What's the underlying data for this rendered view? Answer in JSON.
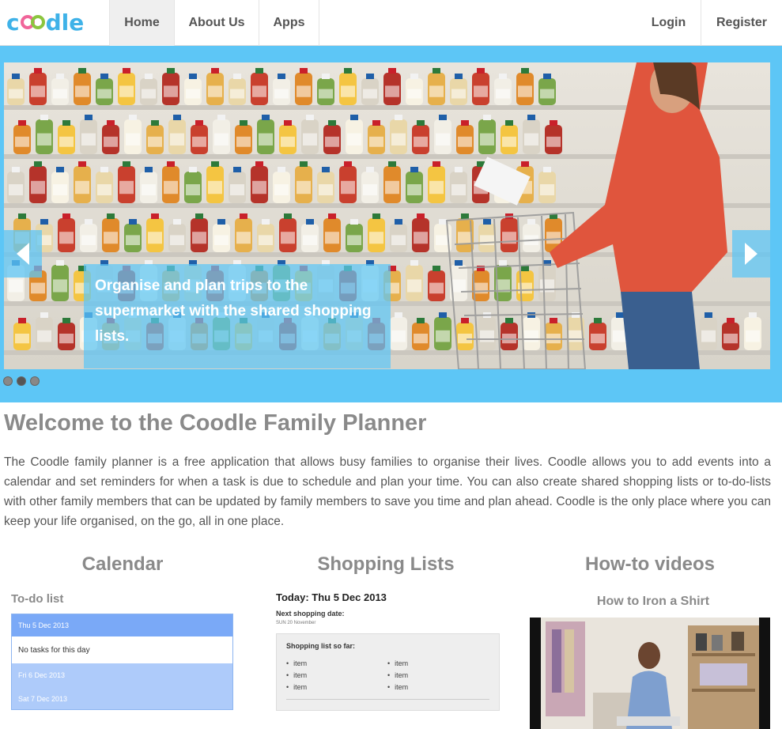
{
  "nav": {
    "logo": "coodle",
    "items": [
      "Home",
      "About Us",
      "Apps"
    ],
    "right": [
      "Login",
      "Register"
    ],
    "active": "Home"
  },
  "hero": {
    "caption": "Organise and plan trips to the supermarket with the shared shopping lists.",
    "slide_count": 3,
    "active_slide": 2
  },
  "welcome": {
    "title": "Welcome to the Coodle Family Planner",
    "body": "The Coodle family planner is a free application that allows busy families to organise their lives. Coodle allows you to add events into a calendar and set reminders for when a task is due to schedule and plan your time. You can also create shared shopping lists or to-do-lists with other family members that can be updated by family members to save you time and plan ahead. Coodle is the only place where you can keep your life organised, on the go, all in one place."
  },
  "columns": {
    "calendar": {
      "title": "Calendar",
      "todo_title": "To-do list",
      "rows": [
        "Thu 5 Dec 2013",
        "No tasks for this day",
        "Fri 6 Dec 2013",
        "Sat 7 Dec 2013"
      ]
    },
    "shopping": {
      "title": "Shopping Lists",
      "today": "Today: Thu 5 Dec 2013",
      "next_label": "Next shopping date:",
      "next_date": "SUN 20 November",
      "box_title": "Shopping list so far:",
      "items_left": [
        "item",
        "item",
        "item"
      ],
      "items_right": [
        "item",
        "item",
        "item"
      ]
    },
    "videos": {
      "title": "How-to videos",
      "subtitle": "How to Iron a Shirt"
    }
  },
  "colors": {
    "brand": "#5dc6f6",
    "heading": "#8a8a8a",
    "todo_header": "#7aa9f7"
  }
}
